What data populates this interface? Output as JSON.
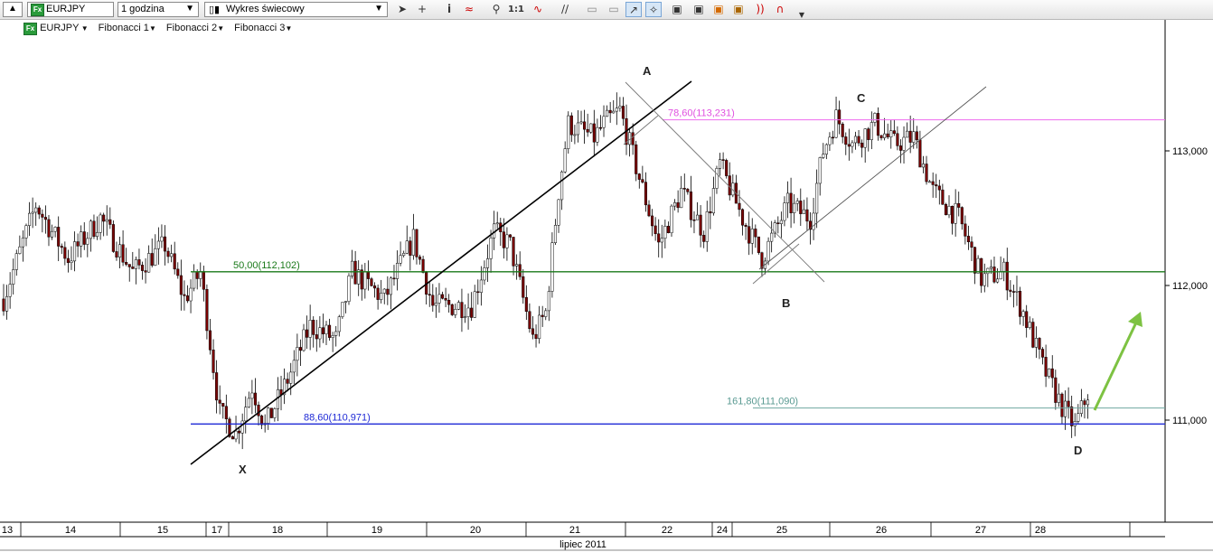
{
  "toolbar": {
    "symbol_value": "EURJPY",
    "interval_value": "1 godzina",
    "chart_style_value": "Wykres świecowy",
    "zoom_label": "1:1",
    "tools": [
      "cursor-icon",
      "crosshair-icon",
      "info-icon",
      "indicator-icon",
      "zoom-icon",
      "zoom-reset",
      "wave-icon",
      "parallel-lines-icon",
      "eraser-icon",
      "erase-all-icon",
      "draw-icon",
      "pattern-icon",
      "template-icon",
      "save-template-icon",
      "color-icon",
      "oscillator-icon",
      "sound-icon",
      "magnet-icon",
      "more-icon"
    ]
  },
  "legend": {
    "symbol": "EURJPY",
    "items": [
      "Fibonacci 1",
      "Fibonacci 2",
      "Fibonacci 3"
    ]
  },
  "colors": {
    "bull_candle": "#ffffff",
    "bear_candle": "#7a0000",
    "fib_50": "#1a7a1a",
    "fib_886": "#1f2ad6",
    "fib_786": "#ee6cee",
    "fib_1618": "#6fa7a0",
    "arrow": "#7dc242"
  },
  "chart_data": {
    "type": "candlestick",
    "symbol": "EURJPY",
    "interval": "1 godzina",
    "ylim": [
      110.21,
      114.04
    ],
    "y_ticks": [
      "113,000",
      "112,000",
      "111,000"
    ],
    "y_tick_values": [
      113.0,
      112.0,
      111.0
    ],
    "x_day_labels": [
      "13",
      "14",
      "15",
      "17",
      "18",
      "19",
      "20",
      "21",
      "22",
      "24",
      "25",
      "26",
      "27",
      "28"
    ],
    "x_month_label": "lipiec 2011",
    "fib_levels": [
      {
        "label": "50,00(112,102)",
        "value": 112.102,
        "color": "#1a7a1a"
      },
      {
        "label": "88,60(110,971)",
        "value": 110.971,
        "color": "#1f2ad6"
      },
      {
        "label": "78,60(113,231)",
        "value": 113.231,
        "color": "#ee6cee"
      },
      {
        "label": "161,80(111,090)",
        "value": 111.09,
        "color": "#6fa7a0"
      }
    ],
    "pattern_points": [
      {
        "label": "X",
        "value": 110.65
      },
      {
        "label": "A",
        "value": 113.55
      },
      {
        "label": "B",
        "value": 112.0
      },
      {
        "label": "C",
        "value": 113.55
      },
      {
        "label": "D",
        "value": 110.85
      }
    ],
    "waypoints": [
      [
        0,
        111.9
      ],
      [
        10,
        112.6
      ],
      [
        20,
        112.2
      ],
      [
        30,
        112.5
      ],
      [
        40,
        112.1
      ],
      [
        50,
        112.3
      ],
      [
        56,
        111.9
      ],
      [
        61,
        112.1
      ],
      [
        67,
        111.05
      ],
      [
        72,
        110.9
      ],
      [
        77,
        111.25
      ],
      [
        81,
        110.95
      ],
      [
        88,
        111.3
      ],
      [
        95,
        111.7
      ],
      [
        103,
        111.6
      ],
      [
        108,
        112.1
      ],
      [
        118,
        111.9
      ],
      [
        127,
        112.35
      ],
      [
        133,
        111.85
      ],
      [
        145,
        111.85
      ],
      [
        152,
        112.4
      ],
      [
        157,
        112.3
      ],
      [
        164,
        111.6
      ],
      [
        168,
        111.8
      ],
      [
        172,
        112.7
      ],
      [
        175,
        113.2
      ],
      [
        183,
        113.1
      ],
      [
        186,
        113.2
      ],
      [
        191,
        113.3
      ],
      [
        197,
        112.8
      ],
      [
        203,
        112.3
      ],
      [
        210,
        112.7
      ],
      [
        217,
        112.4
      ],
      [
        222,
        112.9
      ],
      [
        229,
        112.5
      ],
      [
        235,
        112.2
      ],
      [
        243,
        112.6
      ],
      [
        250,
        112.5
      ],
      [
        254,
        113.0
      ],
      [
        258,
        113.25
      ],
      [
        263,
        113.05
      ],
      [
        270,
        113.2
      ],
      [
        276,
        113.05
      ],
      [
        282,
        113.1
      ],
      [
        288,
        112.7
      ],
      [
        296,
        112.5
      ],
      [
        303,
        112.05
      ],
      [
        310,
        112.1
      ],
      [
        316,
        111.8
      ],
      [
        322,
        111.4
      ],
      [
        328,
        111.1
      ],
      [
        332,
        110.95
      ],
      [
        336,
        111.2
      ]
    ]
  }
}
